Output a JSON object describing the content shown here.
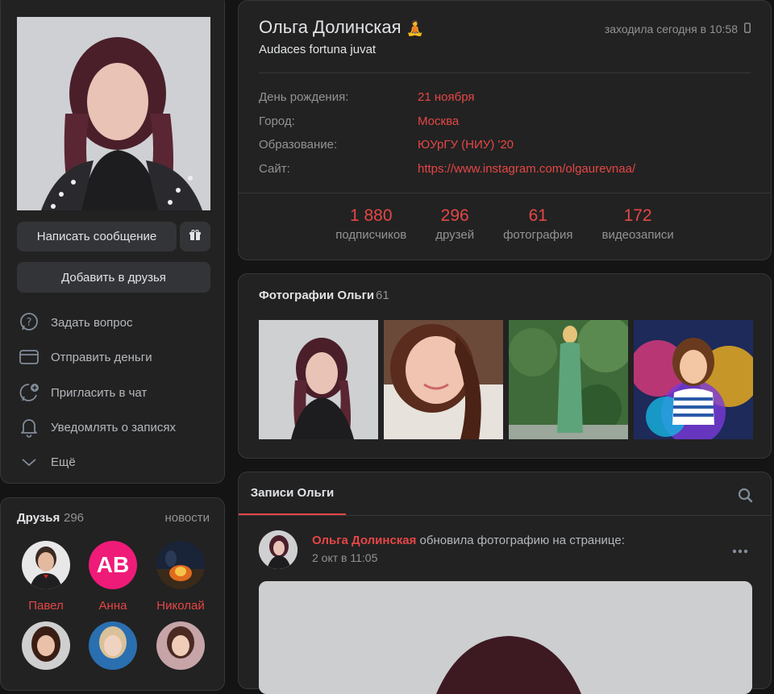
{
  "profile": {
    "name": "Ольга Долинская",
    "name_emoji": "🧘",
    "status": "Audaces fortuna juvat",
    "online": "заходила сегодня в 10:58"
  },
  "actions": {
    "message": "Написать сообщение",
    "add_friend": "Добавить в друзья"
  },
  "menu": [
    {
      "label": "Задать вопрос",
      "icon": "question-icon"
    },
    {
      "label": "Отправить деньги",
      "icon": "money-icon"
    },
    {
      "label": "Пригласить в чат",
      "icon": "chat-plus-icon"
    },
    {
      "label": "Уведомлять о записях",
      "icon": "bell-icon"
    },
    {
      "label": "Ещё",
      "icon": "chevron-down-icon"
    }
  ],
  "info": [
    {
      "label": "День рождения:",
      "value": "21 ноября"
    },
    {
      "label": "Город:",
      "value": "Москва"
    },
    {
      "label": "Образование:",
      "value": "ЮУрГУ (НИУ) '20"
    },
    {
      "label": "Сайт:",
      "value": "https://www.instagram.com/olgaurevnaa/"
    }
  ],
  "stats": [
    {
      "num": "1 880",
      "label": "подписчиков"
    },
    {
      "num": "296",
      "label": "друзей"
    },
    {
      "num": "61",
      "label": "фотография"
    },
    {
      "num": "172",
      "label": "видеозаписи"
    }
  ],
  "photos": {
    "title": "Фотографии Ольги",
    "count": "61"
  },
  "friends": {
    "title": "Друзья",
    "count": "296",
    "news": "новости",
    "items": [
      {
        "name": "Павел"
      },
      {
        "name": "Анна",
        "avatar_text": "AB"
      },
      {
        "name": "Николай"
      }
    ]
  },
  "wall": {
    "tab": "Записи Ольги",
    "post": {
      "author": "Ольга Долинская",
      "action": " обновила фотографию на странице:",
      "date": "2 окт в 11:05"
    }
  },
  "colors": {
    "accent": "#e64646",
    "card_bg": "#222222",
    "page_bg": "#141414"
  }
}
